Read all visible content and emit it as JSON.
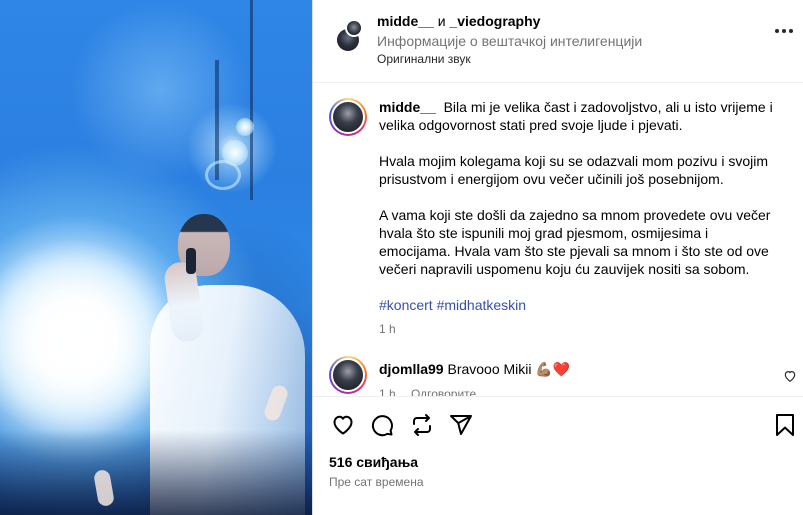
{
  "header": {
    "author": "midde__",
    "joiner": "и",
    "coauthor": "_viedography",
    "subtitle": "Информације о вештачкој интелигенцији",
    "audio": "Оригинални звук",
    "more_icon": "more-horizontal-icon"
  },
  "caption": {
    "username": "midde__",
    "paragraph1": "Bila mi je velika čast i zadovoljstvo, ali u isto vrijeme i velika odgovornost stati pred svoje ljude i pjevati.",
    "paragraph2": "Hvala mojim kolegama koji su se odazvali mom pozivu i svojim prisustvom i energijom ovu večer učinili još posebnijom.",
    "paragraph3": "A vama koji ste došli da zajedno sa mnom provedete ovu večer hvala što ste ispunili moj grad pjesmom, osmijesima i emocijama. Hvala vam što ste pjevali sa mnom i što ste od ove večeri napravili uspomenu koju ću zauvijek nositi sa sobom.",
    "hashtags": "#koncert #midhatkeskin",
    "time": "1 h"
  },
  "comments": [
    {
      "username": "djomlla99",
      "text": "Bravooo Mikii 💪🏽❤️",
      "time": "1 h",
      "reply_label": "Одговорите"
    }
  ],
  "actions": {
    "icons": [
      "heart-icon",
      "comment-icon",
      "share-icon",
      "send-icon",
      "bookmark-icon"
    ]
  },
  "likes": "516 свиђања",
  "posted": "Пре сат времена",
  "colors": {
    "hashtag": "#3950a6",
    "secondary_text": "#737373",
    "border": "#dbdbdb"
  }
}
